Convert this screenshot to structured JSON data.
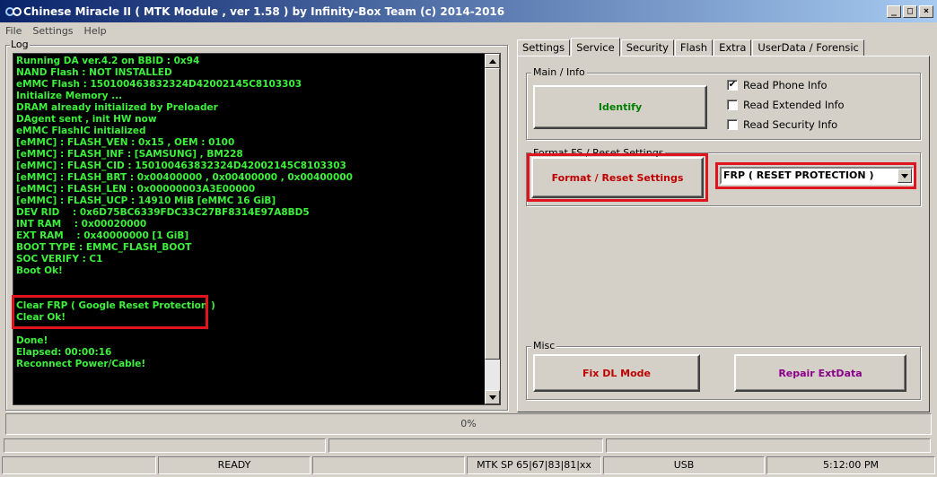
{
  "window": {
    "title": "Chinese Miracle II ( MTK Module , ver 1.58 ) by Infinity-Box Team (c) 2014-2016",
    "controls": {
      "minimize": "_",
      "maximize": "□",
      "close": "×"
    }
  },
  "menu": [
    "File",
    "Settings",
    "Help"
  ],
  "log": {
    "title": "Log",
    "lines": [
      "Running DA ver.4.2 on BBID : 0x94",
      "NAND Flash : NOT INSTALLED",
      "eMMC Flash : 150100463832324D42002145C8103303",
      "Initialize Memory ...",
      "DRAM already initialized by Preloader",
      "DAgent sent , init HW now",
      "eMMC FlashIC initialized",
      "[eMMC] : FLASH_VEN : 0x15 , OEM : 0100",
      "[eMMC] : FLASH_INF : [SAMSUNG] , BM228",
      "[eMMC] : FLASH_CID : 150100463832324D42002145C8103303",
      "[eMMC] : FLASH_BRT : 0x00400000 , 0x00400000 , 0x00400000",
      "[eMMC] : FLASH_LEN : 0x00000003A3E00000",
      "[eMMC] : FLASH_UCP : 14910 MiB [eMMC 16 GiB]",
      "DEV RID    : 0x6D75BC6339FDC33C27BF8314E97A8BD5",
      "INT RAM    : 0x00020000",
      "EXT RAM    : 0x40000000 [1 GiB]",
      "BOOT TYPE : EMMC_FLASH_BOOT",
      "SOC VERIFY : C1",
      "Boot Ok!",
      "",
      "",
      "Clear FRP ( Google Reset Protection )",
      "Clear Ok!",
      "",
      "Done!",
      "Elapsed: 00:00:16",
      "Reconnect Power/Cable!"
    ]
  },
  "tabs": [
    {
      "label": "Settings",
      "active": false
    },
    {
      "label": "Service",
      "active": true
    },
    {
      "label": "Security",
      "active": false
    },
    {
      "label": "Flash",
      "active": false
    },
    {
      "label": "Extra",
      "active": false
    },
    {
      "label": "UserData / Forensic",
      "active": false
    }
  ],
  "service": {
    "main_info": {
      "title": "Main / Info",
      "identify_label": "Identify",
      "checkboxes": [
        {
          "label": "Read Phone Info",
          "checked": true
        },
        {
          "label": "Read Extended Info",
          "checked": false
        },
        {
          "label": "Read Security Info",
          "checked": false
        }
      ]
    },
    "format": {
      "title": "Format FS / Reset Settings",
      "button_label": "Format / Reset Settings",
      "selected_option": "FRP ( RESET PROTECTION )"
    },
    "misc": {
      "title": "Misc",
      "fix_dl_label": "Fix DL Mode",
      "repair_label": "Repair ExtData"
    }
  },
  "progress": {
    "value": 0,
    "label": "0%"
  },
  "status": {
    "ready": "READY",
    "platform": "MTK SP 65|67|83|81|xx",
    "interface": "USB",
    "time": "5:12:00 PM"
  },
  "colors": {
    "log_text": "#3cf03c",
    "identify_text": "#008000",
    "format_text": "#c00000",
    "fix_dl_text": "#c00000",
    "repair_text": "#8b008b",
    "highlight": "#e0141e"
  }
}
